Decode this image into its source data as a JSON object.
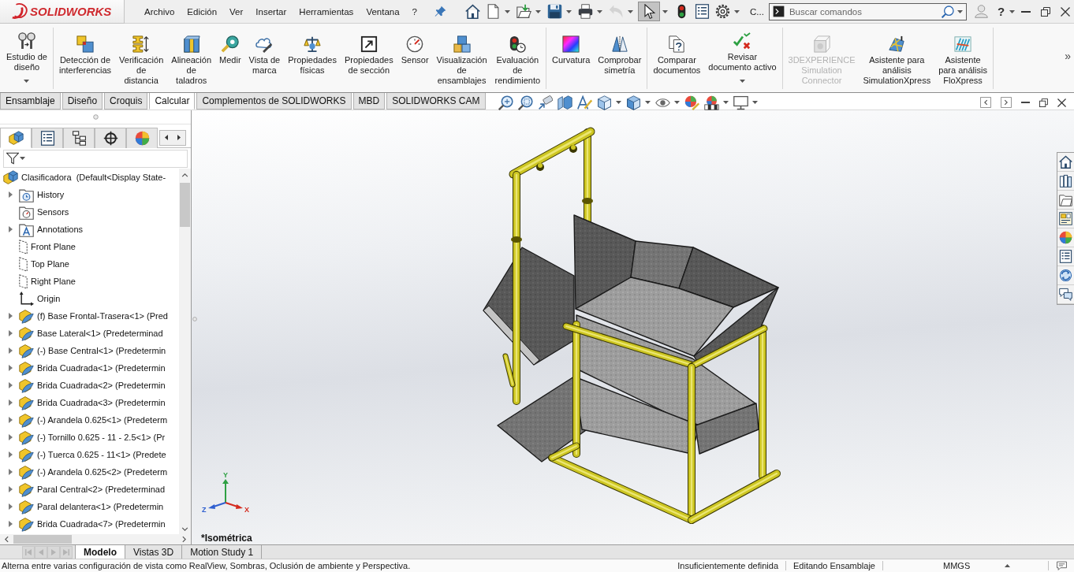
{
  "title_bar": {
    "logo_text": "SOLIDWORKS",
    "menu": [
      "Archivo",
      "Edición",
      "Ver",
      "Insertar",
      "Herramientas",
      "Ventana",
      "?"
    ],
    "quick_access": [
      {
        "kind": "home",
        "dropdown": false,
        "pressed": false,
        "disabled": false
      },
      {
        "kind": "new",
        "dropdown": true,
        "pressed": false,
        "disabled": false
      },
      {
        "kind": "open",
        "dropdown": true,
        "pressed": false,
        "disabled": false
      },
      {
        "kind": "save",
        "dropdown": true,
        "pressed": false,
        "disabled": false
      },
      {
        "kind": "print",
        "dropdown": true,
        "pressed": false,
        "disabled": false
      },
      {
        "kind": "undo",
        "dropdown": true,
        "pressed": false,
        "disabled": true
      },
      {
        "kind": "select",
        "dropdown": true,
        "pressed": true,
        "disabled": false
      },
      {
        "kind": "rebuild",
        "dropdown": false,
        "pressed": false,
        "disabled": false
      },
      {
        "kind": "file-properties",
        "dropdown": false,
        "pressed": false,
        "disabled": false
      },
      {
        "kind": "options",
        "dropdown": true,
        "pressed": false,
        "disabled": false
      }
    ],
    "document_label": "C...",
    "search": {
      "placeholder": "Buscar comandos"
    },
    "help_label": "?"
  },
  "command_manager": {
    "groups": [
      [
        {
          "label": "Estudio de\ndiseño",
          "kind": "design-study",
          "dropdown": true,
          "disabled": false
        }
      ],
      [
        {
          "label": "Detección de\ninterferencias",
          "kind": "interference",
          "dropdown": false,
          "disabled": false
        },
        {
          "label": "Verificación\nde\ndistancia",
          "kind": "distance",
          "dropdown": false,
          "disabled": false
        },
        {
          "label": "Alineación\nde\ntaladros",
          "kind": "hole-alignment",
          "dropdown": false,
          "disabled": false
        },
        {
          "label": "Medir",
          "kind": "measure",
          "dropdown": false,
          "disabled": false
        },
        {
          "label": "Vista de\nmarca",
          "kind": "bubble-view",
          "dropdown": false,
          "disabled": false
        },
        {
          "label": "Propiedades\nfísicas",
          "kind": "mass-properties",
          "dropdown": false,
          "disabled": false
        },
        {
          "label": "Propiedades\nde sección",
          "kind": "section-properties",
          "dropdown": false,
          "disabled": false
        },
        {
          "label": "Sensor",
          "kind": "sensor",
          "dropdown": false,
          "disabled": false
        },
        {
          "label": "Visualización\nde\nensamblajes",
          "kind": "assembly-visualization",
          "dropdown": false,
          "disabled": false
        },
        {
          "label": "Evaluación\nde\nrendimiento",
          "kind": "performance",
          "dropdown": false,
          "disabled": false
        }
      ],
      [
        {
          "label": "Curvatura",
          "kind": "curvature",
          "dropdown": false,
          "disabled": false
        },
        {
          "label": "Comprobar\nsimetría",
          "kind": "symmetry",
          "dropdown": false,
          "disabled": false
        }
      ],
      [
        {
          "label": "Comparar\ndocumentos",
          "kind": "compare",
          "dropdown": false,
          "disabled": false
        },
        {
          "label": "Revisar\ndocumento activo",
          "kind": "check-active",
          "dropdown": true,
          "disabled": false
        }
      ],
      [
        {
          "label": "3DEXPERIENCE\nSimulation\nConnector",
          "kind": "sim-connector",
          "dropdown": false,
          "disabled": true
        },
        {
          "label": "Asistente para\nanálisis\nSimulationXpress",
          "kind": "simulationxpress",
          "dropdown": false,
          "disabled": false
        },
        {
          "label": "Asistente\npara análisis\nFloXpress",
          "kind": "floxpress",
          "dropdown": false,
          "disabled": false
        }
      ]
    ],
    "overflow_label": "»"
  },
  "command_tabs": [
    {
      "label": "Ensamblaje",
      "selected": false
    },
    {
      "label": "Diseño",
      "selected": false
    },
    {
      "label": "Croquis",
      "selected": false
    },
    {
      "label": "Calcular",
      "selected": true
    },
    {
      "label": "Complementos de SOLIDWORKS",
      "selected": false
    },
    {
      "label": "MBD",
      "selected": false
    },
    {
      "label": "SOLIDWORKS CAM",
      "selected": false
    }
  ],
  "view_toolbar": [
    {
      "kind": "zoom-fit",
      "dropdown": false
    },
    {
      "kind": "zoom-area",
      "dropdown": false
    },
    {
      "kind": "previous-view",
      "dropdown": false
    },
    {
      "kind": "section-view",
      "dropdown": false
    },
    {
      "kind": "annotation-views",
      "dropdown": false
    },
    {
      "kind": "view-orientation",
      "dropdown": true
    },
    {
      "kind": "display-style",
      "dropdown": true
    },
    {
      "kind": "hide-show",
      "dropdown": true
    },
    {
      "kind": "edit-appearance",
      "dropdown": false
    },
    {
      "kind": "apply-scene",
      "dropdown": true
    },
    {
      "kind": "view-settings",
      "dropdown": true
    }
  ],
  "feature_manager": {
    "panel_tabs": [
      {
        "kind": "feature-tree",
        "selected": true
      },
      {
        "kind": "property-manager",
        "selected": false
      },
      {
        "kind": "configuration-manager",
        "selected": false
      },
      {
        "kind": "dimxpert",
        "selected": false
      },
      {
        "kind": "display-manager",
        "selected": false
      }
    ],
    "tree": {
      "label": "Clasificadora  (Default<Display State-",
      "kind": "assembly",
      "children": [
        {
          "label": "History",
          "kind": "history",
          "expanded": false
        },
        {
          "label": "Sensors",
          "kind": "sensors"
        },
        {
          "label": "Annotations",
          "kind": "annotations",
          "expanded": false
        },
        {
          "label": "Front Plane",
          "kind": "plane"
        },
        {
          "label": "Top Plane",
          "kind": "plane"
        },
        {
          "label": "Right Plane",
          "kind": "plane"
        },
        {
          "label": "Origin",
          "kind": "origin"
        },
        {
          "label": "(f) Base Frontal-Trasera<1> (Pred",
          "kind": "part",
          "expanded": false
        },
        {
          "label": "Base Lateral<1> (Predeterminad",
          "kind": "part",
          "expanded": false
        },
        {
          "label": "(-) Base Central<1> (Predetermin",
          "kind": "part",
          "expanded": false
        },
        {
          "label": "Brida Cuadrada<1> (Predetermin",
          "kind": "part",
          "expanded": false
        },
        {
          "label": "Brida Cuadrada<2> (Predetermin",
          "kind": "part",
          "expanded": false
        },
        {
          "label": "Brida Cuadrada<3> (Predetermin",
          "kind": "part",
          "expanded": false
        },
        {
          "label": "(-) Arandela 0.625<1> (Predeterm",
          "kind": "part",
          "expanded": false
        },
        {
          "label": "(-) Tornillo 0.625 - 11 - 2.5<1> (Pr",
          "kind": "part",
          "expanded": false
        },
        {
          "label": "(-) Tuerca 0.625 - 11<1> (Predete",
          "kind": "part",
          "expanded": false
        },
        {
          "label": "(-) Arandela 0.625<2> (Predeterm",
          "kind": "part",
          "expanded": false
        },
        {
          "label": "Paral Central<2> (Predeterminad",
          "kind": "part",
          "expanded": false
        },
        {
          "label": "Paral delantera<1> (Predetermin",
          "kind": "part",
          "expanded": false
        },
        {
          "label": "Brida Cuadrada<7> (Predetermin",
          "kind": "part",
          "expanded": false
        }
      ]
    }
  },
  "viewport": {
    "view_label": "*Isométrica",
    "triad": {
      "x": "X",
      "y": "Y",
      "z": "Z"
    }
  },
  "task_pane": [
    {
      "kind": "resources"
    },
    {
      "kind": "design-library"
    },
    {
      "kind": "file-explorer"
    },
    {
      "kind": "view-palette"
    },
    {
      "kind": "appearances"
    },
    {
      "kind": "custom-properties"
    },
    {
      "kind": "forum"
    },
    {
      "kind": "comments"
    }
  ],
  "bottom_tabs": [
    {
      "label": "Modelo",
      "selected": true
    },
    {
      "label": "Vistas 3D",
      "selected": false
    },
    {
      "label": "Motion Study 1",
      "selected": false
    }
  ],
  "status_bar": {
    "message": "Alterna entre varias configuración de vista como RealView, Sombras, Oclusión de ambiente y Perspectiva.",
    "definition": "Insuficientemente definida",
    "mode": "Editando Ensamblaje",
    "units": "MMGS"
  }
}
